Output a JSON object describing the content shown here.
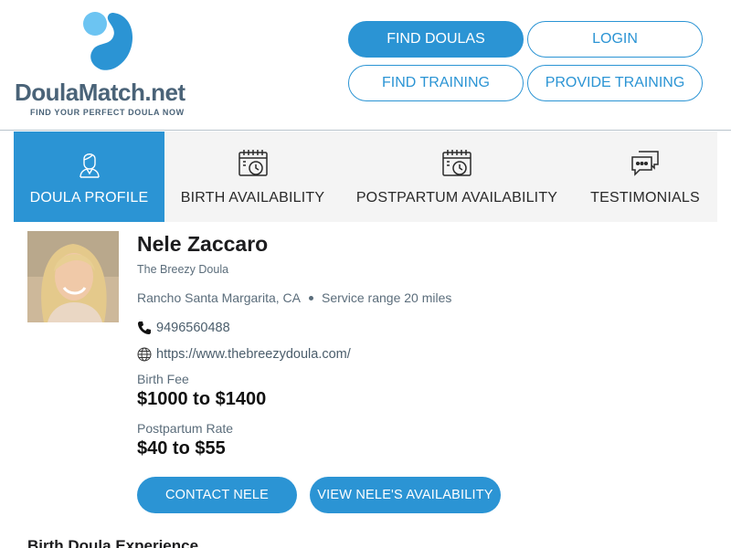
{
  "brand": {
    "name_main": "DoulaMatch",
    "name_suffix": ".net",
    "tagline": "FIND YOUR PERFECT DOULA NOW",
    "accent_color": "#2b94d4",
    "light_accent_color": "#6cc4f2"
  },
  "nav": {
    "find_doulas": "FIND DOULAS",
    "login": "LOGIN",
    "find_training": "FIND TRAINING",
    "provide_training": "PROVIDE TRAINING"
  },
  "tabs": [
    {
      "label": "DOULA PROFILE",
      "icon": "doula-person-icon",
      "active": true
    },
    {
      "label": "BIRTH AVAILABILITY",
      "icon": "calendar-clock-icon",
      "active": false
    },
    {
      "label": "POSTPARTUM AVAILABILITY",
      "icon": "calendar-clock-icon",
      "active": false
    },
    {
      "label": "TESTIMONIALS",
      "icon": "chat-bubbles-icon",
      "active": false
    }
  ],
  "profile": {
    "name": "Nele Zaccaro",
    "business": "The Breezy Doula",
    "location": "Rancho Santa Margarita, CA",
    "service_range": "Service range 20 miles",
    "phone": "9496560488",
    "website": "https://www.thebreezydoula.com/",
    "birth_fee_label": "Birth Fee",
    "birth_fee": "$1000 to $1400",
    "postpartum_label": "Postpartum Rate",
    "postpartum_rate": "$40 to $55",
    "contact_button": "CONTACT NELE",
    "availability_button": "VIEW NELE'S AVAILABILITY"
  },
  "section": {
    "heading": "Birth Doula Experience"
  }
}
